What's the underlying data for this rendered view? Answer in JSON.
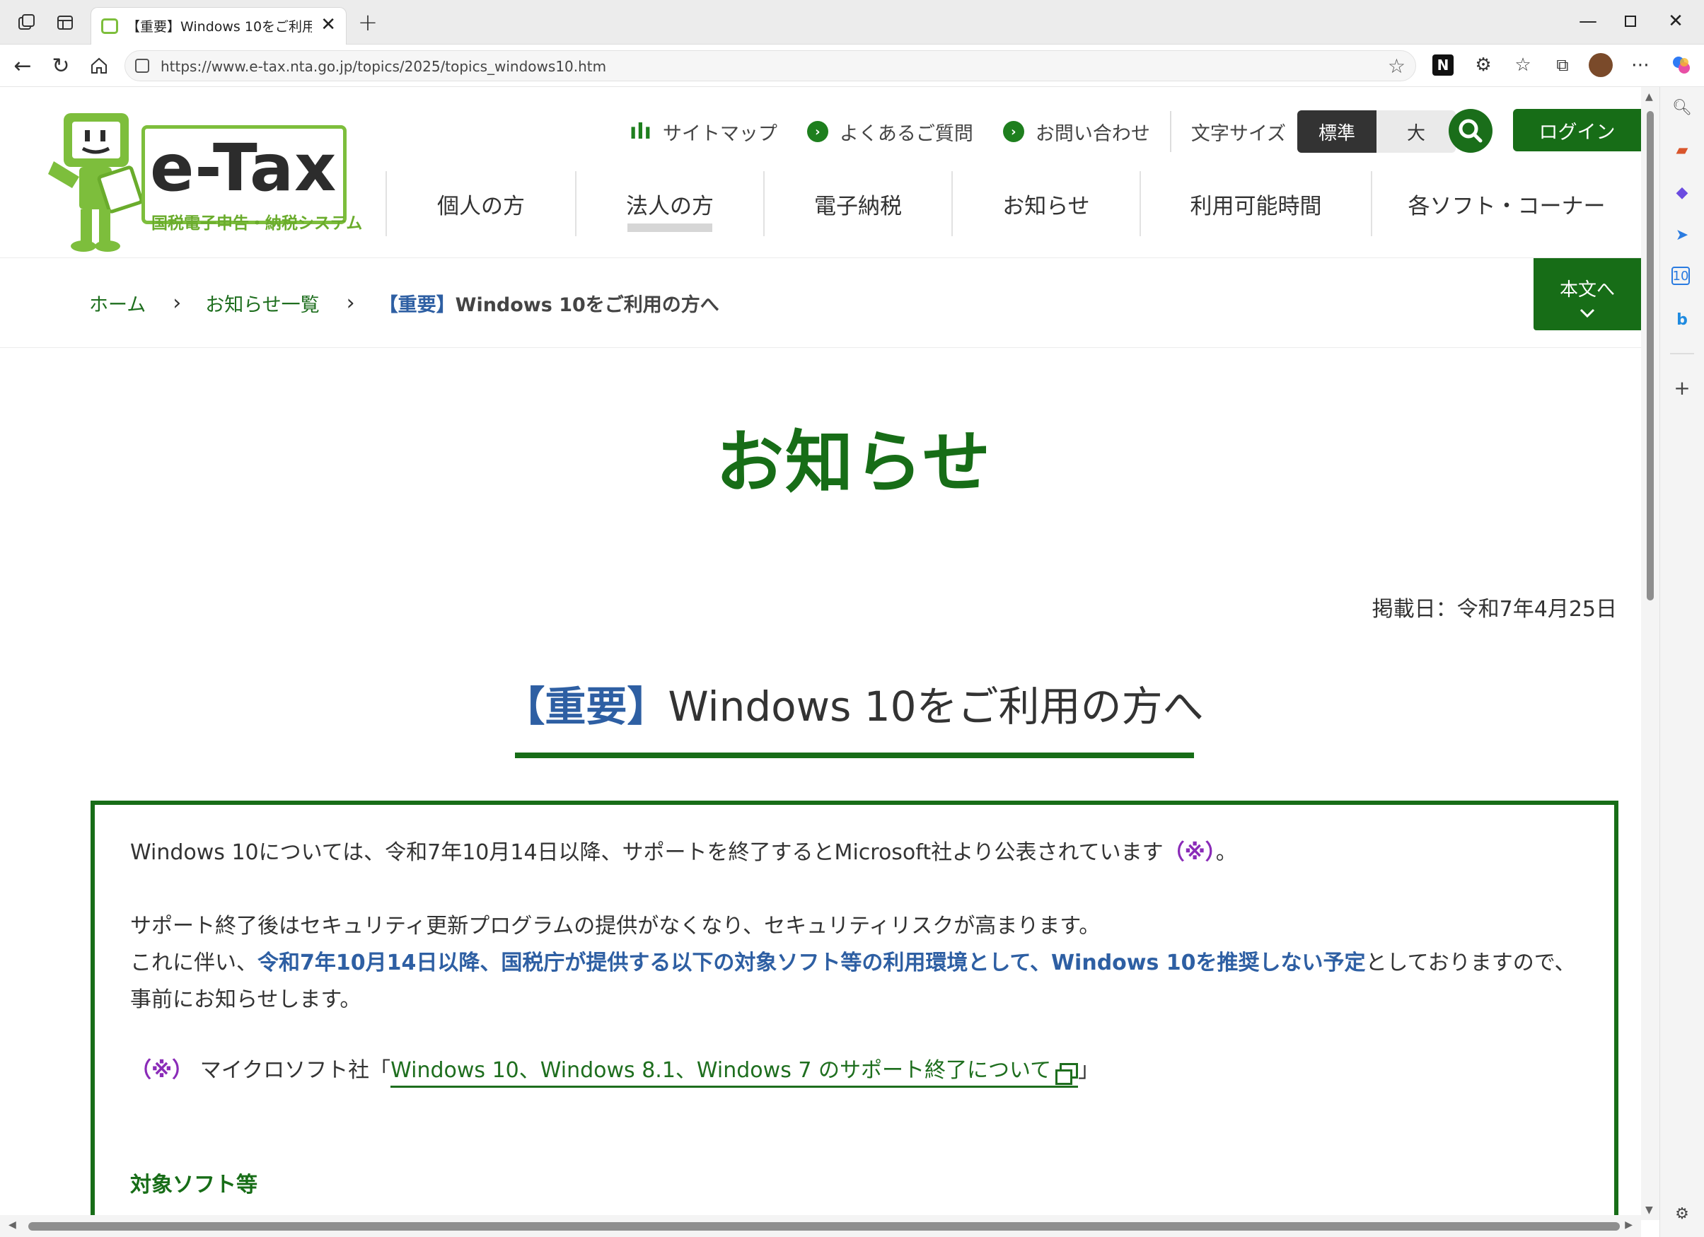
{
  "browser": {
    "tab_title": "【重要】Windows 10をご利用の方へ",
    "url": "https://www.e-tax.nta.go.jp/topics/2025/topics_windows10.htm"
  },
  "header": {
    "logo_text": "e-Tax",
    "logo_subtitle": "国税電子申告・納税システム",
    "util_links": {
      "sitemap": "サイトマップ",
      "faq": "よくあるご質問",
      "contact": "お問い合わせ"
    },
    "font_size_label": "文字サイズ",
    "font_size_standard": "標準",
    "font_size_large": "大",
    "login": "ログイン",
    "nav": [
      "個人の方",
      "法人の方",
      "電子納税",
      "お知らせ",
      "利用可能時間",
      "各ソフト・コーナー"
    ]
  },
  "breadcrumb": {
    "home": "ホーム",
    "list": "お知らせ一覧",
    "current_imp": "【重要】",
    "current_rest": "Windows 10をご利用の方へ"
  },
  "skip_to_content": "本文へ",
  "page_title": "お知らせ",
  "posted_date": "掲載日：令和7年4月25日",
  "article": {
    "title_imp": "【重要】",
    "title_rest": "Windows 10をご利用の方へ",
    "p1_text": "Windows 10については、令和7年10月14日以降、サポートを終了するとMicrosoft社より公表されています",
    "p1_note": "（※）",
    "p1_end": "。",
    "p2_line1": "サポート終了後はセキュリティ更新プログラムの提供がなくなり、セキュリティリスクが高まります。",
    "p2_line2_pre": "これに伴い、",
    "p2_line2_bold": "令和7年10月14日以降、国税庁が提供する以下の対象ソフト等の利用環境として、Windows 10を推奨しない予定",
    "p2_line2_post": "としておりますので、",
    "p2_line3": "事前にお知らせします。",
    "note_mark": "（※）",
    "note_text": "マイクロソフト社「",
    "note_link": "Windows 10、Windows 8.1、Windows 7 のサポート終了について",
    "note_close": "」",
    "section_heading": "対象ソフト等"
  }
}
